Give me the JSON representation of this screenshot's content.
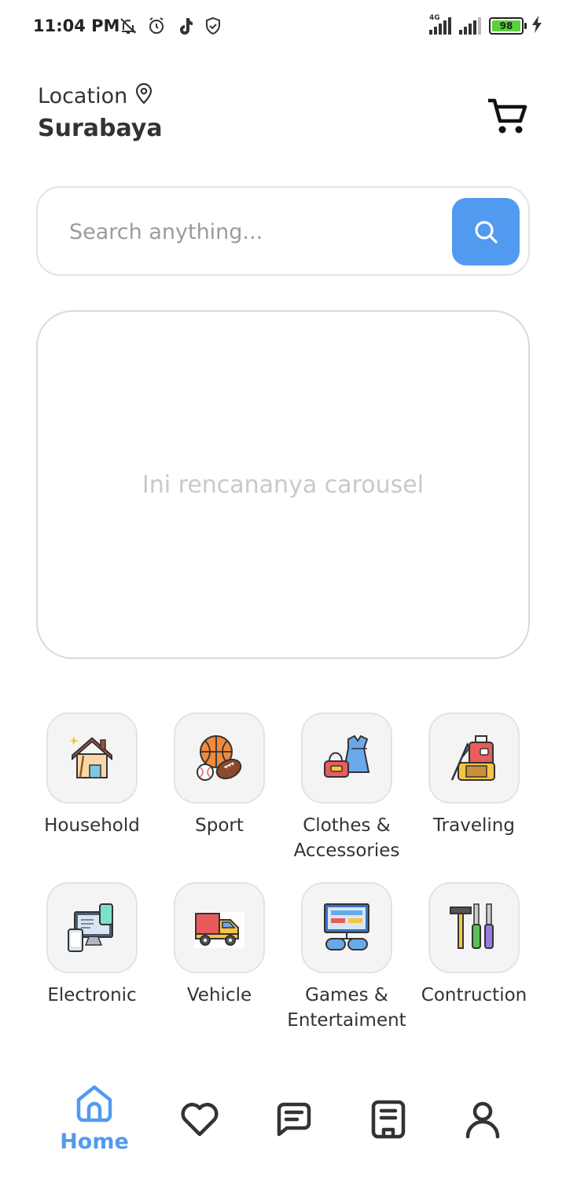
{
  "status_bar": {
    "time": "11:04 PM",
    "icons": [
      "bell-off-icon",
      "alarm-icon",
      "tiktok-icon",
      "shield-icon"
    ],
    "network_label": "4G",
    "battery_level": "98"
  },
  "header": {
    "location_label": "Location",
    "city": "Surabaya"
  },
  "search": {
    "placeholder": "Search anything..."
  },
  "carousel": {
    "placeholder_text": "Ini rencananya carousel"
  },
  "categories": [
    {
      "label": "Household",
      "icon": "household-icon"
    },
    {
      "label": "Sport",
      "icon": "sport-icon"
    },
    {
      "label": "Clothes & Accessories",
      "icon": "clothes-icon"
    },
    {
      "label": "Traveling",
      "icon": "traveling-icon"
    },
    {
      "label": "Electronic",
      "icon": "electronic-icon"
    },
    {
      "label": "Vehicle",
      "icon": "vehicle-icon"
    },
    {
      "label": "Games & Entertaiment",
      "icon": "games-icon"
    },
    {
      "label": "Contruction",
      "icon": "construction-icon"
    }
  ],
  "bottom_nav": {
    "items": [
      {
        "label": "Home",
        "icon": "home-icon",
        "active": true
      },
      {
        "label": "",
        "icon": "heart-icon",
        "active": false
      },
      {
        "label": "",
        "icon": "chat-icon",
        "active": false
      },
      {
        "label": "",
        "icon": "orders-icon",
        "active": false
      },
      {
        "label": "",
        "icon": "profile-icon",
        "active": false
      }
    ]
  },
  "colors": {
    "accent": "#529af0",
    "text": "#333333",
    "muted": "#9b9b9b",
    "tile_bg": "#f4f4f4"
  }
}
